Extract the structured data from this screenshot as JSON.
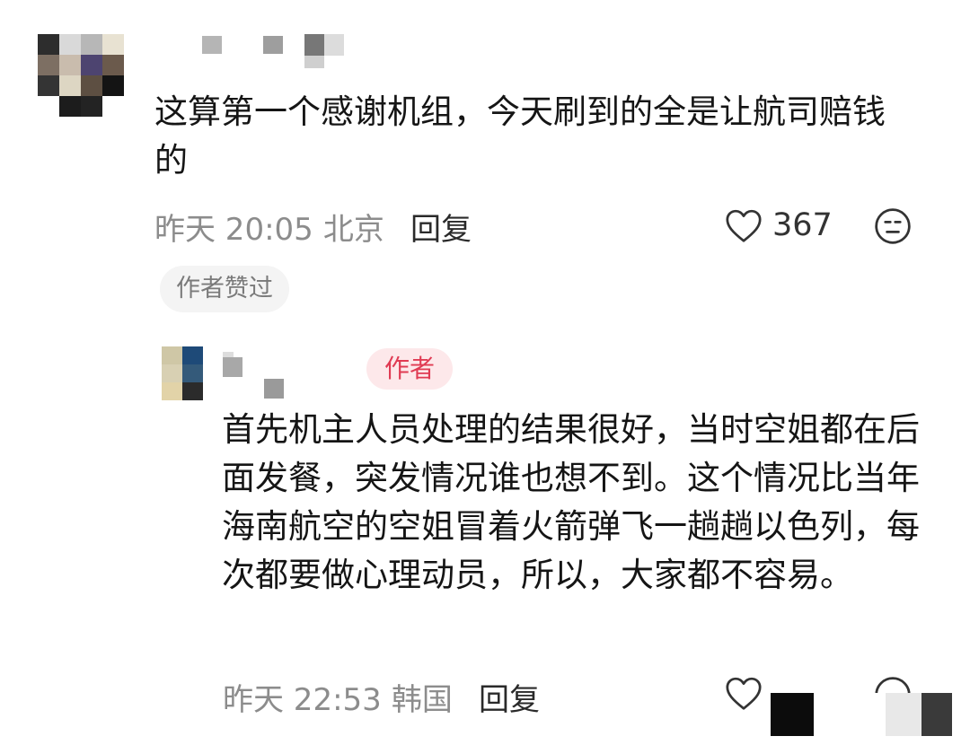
{
  "comment": {
    "text": "这算第一个感谢机组，今天刷到的全是让航司赔钱的",
    "time": "昨天 20:05",
    "location": "北京",
    "reply_label": "回复",
    "like_count": "367",
    "liked_by_author_label": "作者赞过",
    "avatar_colors": [
      "#2d2d2d",
      "#d9d9d9",
      "#b7b7b7",
      "#e8e2d2",
      "#7d6f63",
      "#c9bcad",
      "#4d4470",
      "#6b5a4c",
      "#343434",
      "#ddd6c3",
      "#5d4f42",
      "#141414",
      "#ffffff",
      "#1c1c1c",
      "#232323",
      "#ffffff"
    ]
  },
  "reply": {
    "author_tag": "作者",
    "text": "首先机主人员处理的结果很好，当时空姐都在后面发餐，突发情况谁也想不到。这个情况比当年海南航空的空姐冒着火箭弹飞一趟趟以色列，每次都要做心理动员，所以，大家都不容易。",
    "time": "昨天 22:53",
    "location": "韩国",
    "reply_label": "回复",
    "avatar_colors": [
      "#cfc7a6",
      "#1e4a78",
      "#d8d0b3",
      "#345a7a",
      "#e2d3a8",
      "#2b2b2b"
    ]
  },
  "colors": {
    "author_badge_bg": "#fde8ea",
    "author_badge_text": "#e03b53",
    "meta_text": "#8c8c8c"
  }
}
